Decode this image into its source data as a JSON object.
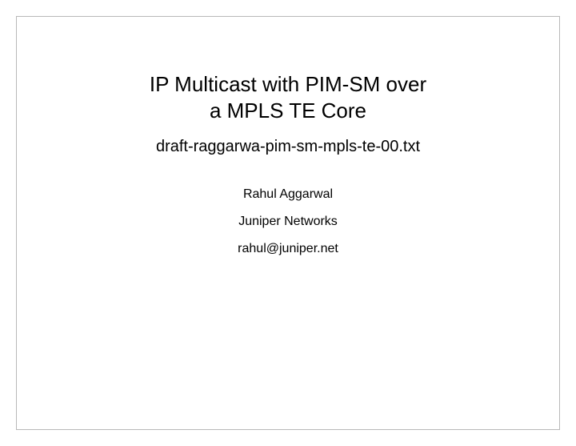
{
  "slide": {
    "title_line1": "IP Multicast with PIM-SM over",
    "title_line2": "a MPLS TE Core",
    "subtitle": "draft-raggarwa-pim-sm-mpls-te-00.txt",
    "author": "Rahul Aggarwal",
    "affiliation": "Juniper Networks",
    "email": "rahul@juniper.net"
  }
}
